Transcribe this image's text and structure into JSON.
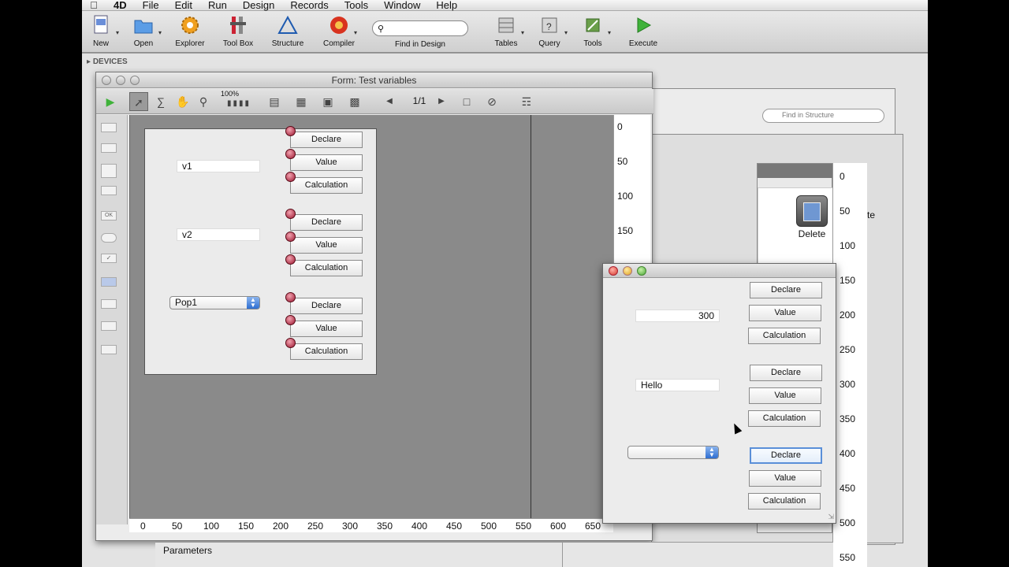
{
  "menubar": {
    "apple": "",
    "app": "4D",
    "items": [
      "File",
      "Edit",
      "Run",
      "Design",
      "Records",
      "Tools",
      "Window",
      "Help"
    ]
  },
  "toolbar": {
    "new": "New",
    "open": "Open",
    "explorer": "Explorer",
    "toolbox": "Tool Box",
    "structure": "Structure",
    "compiler": "Compiler",
    "find_label": "Find in Design",
    "tables": "Tables",
    "query": "Query",
    "tools": "Tools",
    "execute": "Execute"
  },
  "sidebar": {
    "devices": "DEVICES"
  },
  "structure_window": {
    "search_placeholder": "Find in Structure"
  },
  "background_window": {
    "delete_label": "Delete",
    "partial_label": "te"
  },
  "form_window": {
    "title": "Form: Test variables",
    "zoom": "100%",
    "page_indicator": "1/1",
    "fields": {
      "v1": "v1",
      "v2": "v2",
      "popup": "Pop1"
    },
    "group1": {
      "declare": "Declare",
      "value": "Value",
      "calculation": "Calculation"
    },
    "group2": {
      "declare": "Declare",
      "value": "Value",
      "calculation": "Calculation"
    },
    "group3": {
      "declare": "Declare",
      "value": "Value",
      "calculation": "Calculation"
    },
    "vruler": [
      "0",
      "50",
      "100",
      "150"
    ],
    "hruler": [
      "0",
      "50",
      "100",
      "150",
      "200",
      "250",
      "300",
      "350",
      "400",
      "450",
      "500",
      "550",
      "600",
      "650"
    ]
  },
  "parameters": {
    "label": "Parameters"
  },
  "dialog": {
    "v1_value": "300",
    "v2_value": "Hello",
    "popup_value": "",
    "group1": {
      "declare": "Declare",
      "value": "Value",
      "calculation": "Calculation"
    },
    "group2": {
      "declare": "Declare",
      "value": "Value",
      "calculation": "Calculation"
    },
    "group3": {
      "declare": "Declare",
      "value": "Value",
      "calculation": "Calculation"
    }
  },
  "right_ruler": [
    "0",
    "50",
    "100",
    "150",
    "200",
    "250",
    "300",
    "350",
    "400",
    "450",
    "500",
    "550"
  ],
  "colors": {
    "accent_blue": "#2f6fd1",
    "rivet": "#9c1731",
    "canvas": "#8a8a8a"
  }
}
